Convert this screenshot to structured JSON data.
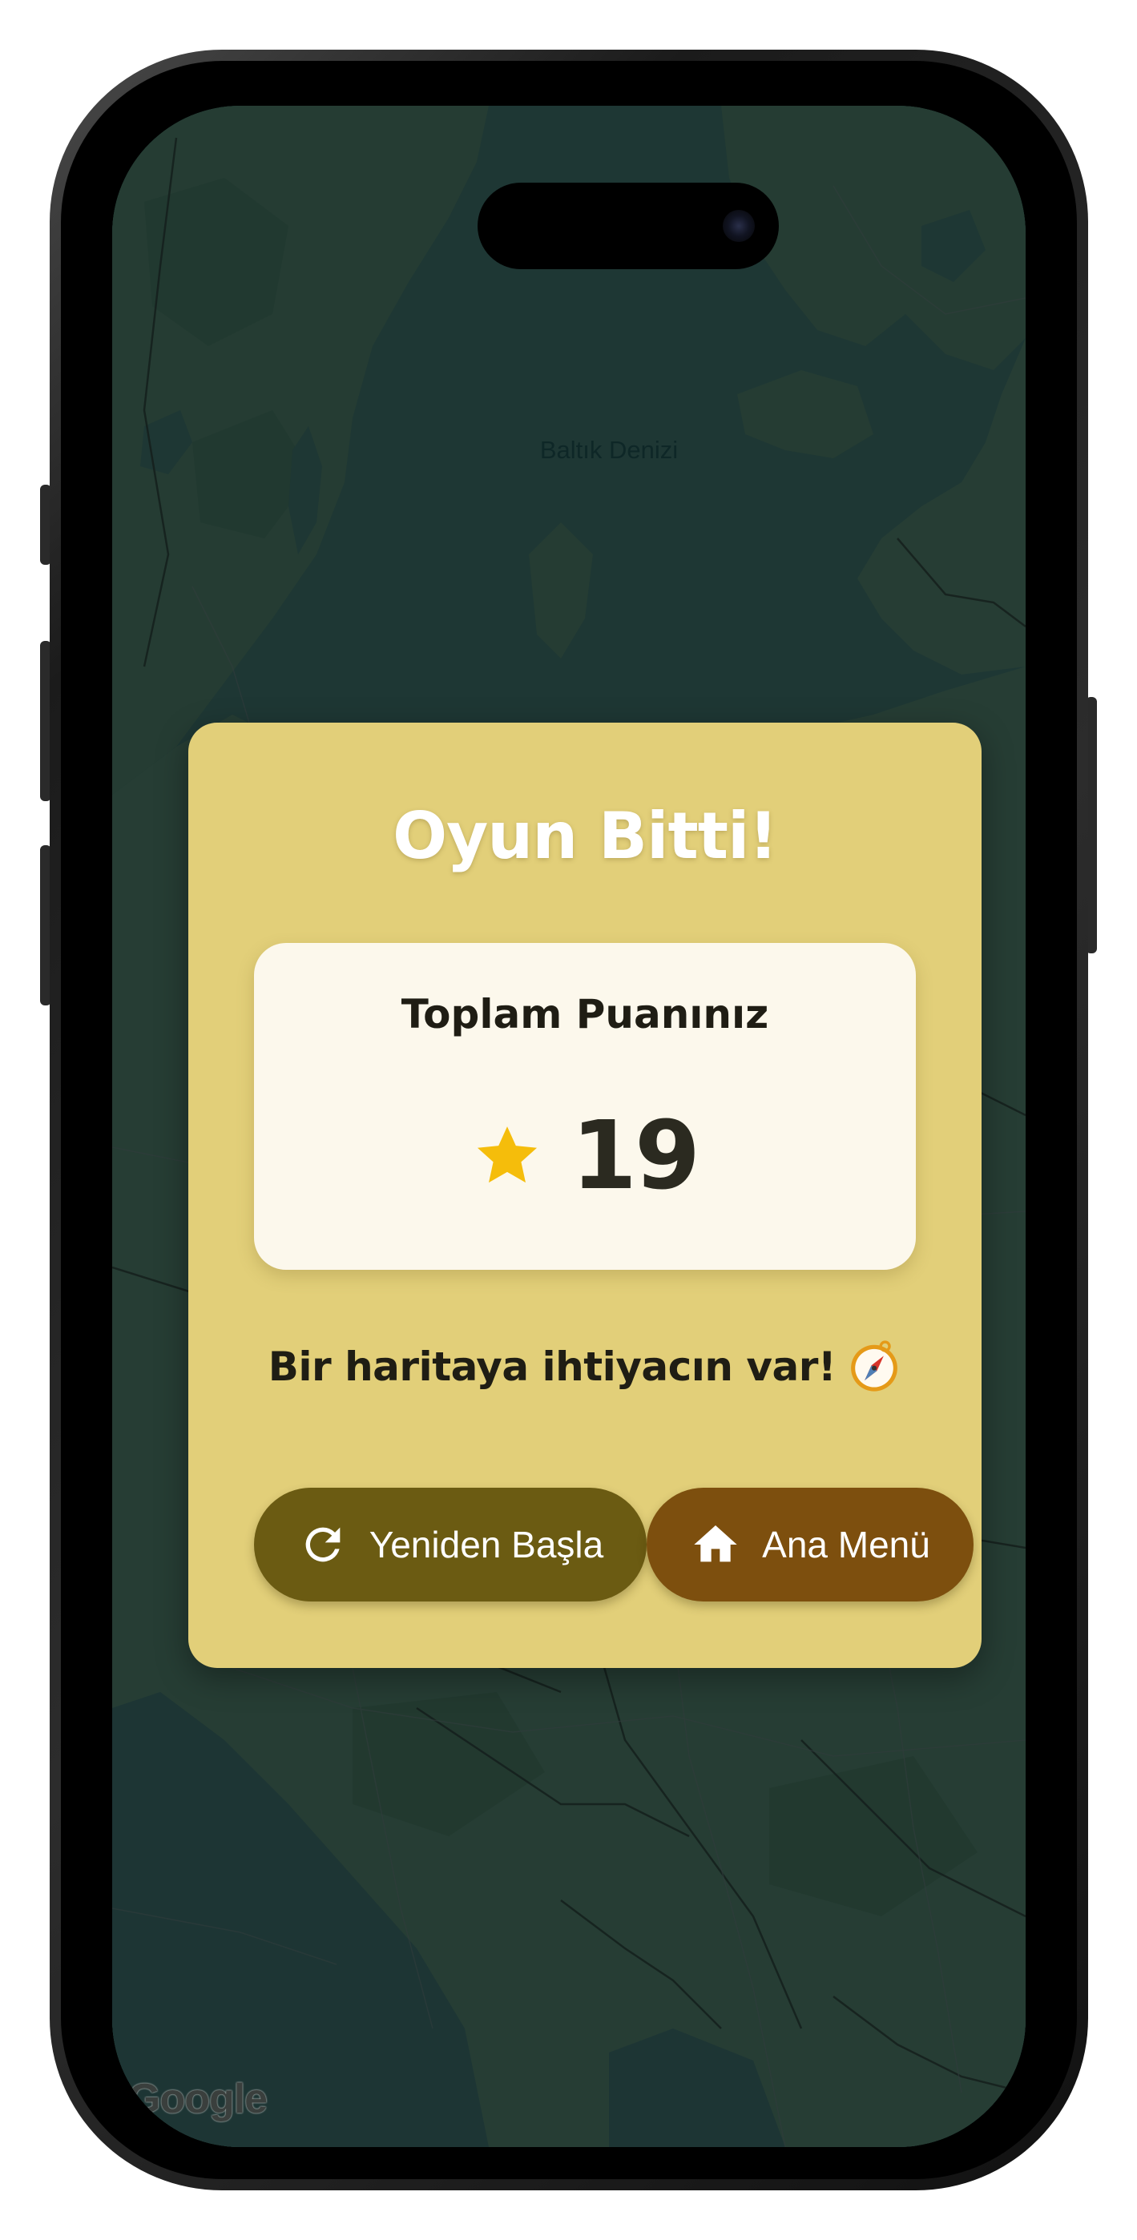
{
  "map": {
    "sea_label": "Baltık Denizi",
    "attribution": "Google"
  },
  "dialog": {
    "title": "Oyun Bitti!",
    "score_label": "Toplam Puanınız",
    "score_value": "19",
    "score_icon": "star-icon",
    "hint": "Bir haritaya ihtiyacın var!",
    "hint_icon": "compass-icon",
    "buttons": {
      "restart_label": "Yeniden Başla",
      "restart_icon": "refresh-icon",
      "home_label": "Ana Menü",
      "home_icon": "home-icon"
    }
  },
  "colors": {
    "dialog_background": "#e2cf79",
    "score_card_background": "#fcf8ec",
    "restart_button": "#6b5b12",
    "home_button": "#7d4f0e",
    "star": "#f5bd0b",
    "title_text": "#ffffff"
  }
}
